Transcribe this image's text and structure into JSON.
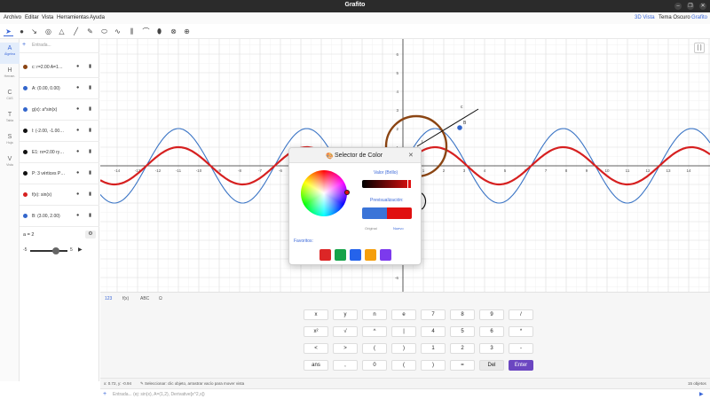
{
  "window": {
    "title": "Grafito",
    "controls": [
      "–",
      "❐",
      "✕"
    ]
  },
  "menu": {
    "items": [
      "Archivo",
      "Editar",
      "Vista",
      "Herramientas",
      "Ayuda"
    ],
    "right": [
      "3D Vista",
      "Tema Oscuro",
      "Grafito"
    ],
    "right_color": "#3a67d8"
  },
  "toolbar": {
    "tools": [
      "pointer",
      "point",
      "pen",
      "circle",
      "polygon",
      "line",
      "pencil",
      "ellipse",
      "wave",
      "ticks",
      "bend",
      "shape",
      "steering",
      "globe"
    ]
  },
  "rail": [
    {
      "letter": "A",
      "label": "Álgebra",
      "active": true
    },
    {
      "letter": "H",
      "label": "Herram.",
      "active": false
    },
    {
      "letter": "C",
      "label": "CAS",
      "active": false
    },
    {
      "letter": "T",
      "label": "Tabla",
      "active": false
    },
    {
      "letter": "S",
      "label": "Hoja",
      "active": false
    },
    {
      "letter": "V",
      "label": "Vista",
      "active": false
    }
  ],
  "algebra": {
    "input_placeholder": "Entrada...",
    "items": [
      {
        "label": "c: r=2.00  A=1…",
        "color": "#8b4513"
      },
      {
        "label": "A: (0.00, 0.00)",
        "color": "#3366cc"
      },
      {
        "label": "g(x): a*sin(x)",
        "color": "#3366cc"
      },
      {
        "label": "l: (-2.00, -1.00…",
        "color": "#111111"
      },
      {
        "label": "E1: rx=2.00 ry…",
        "color": "#111111"
      },
      {
        "label": "P: 3 vértices  P…",
        "color": "#111111"
      },
      {
        "label": "f(x): sin(x)",
        "color": "#d62020"
      },
      {
        "label": "B: (3.00, 2.00)",
        "color": "#3366cc"
      }
    ],
    "slider": {
      "name": "a = 2",
      "min": "-5",
      "max": "5",
      "value": 2,
      "range": [
        -5,
        5
      ]
    }
  },
  "graph": {
    "x_ticks": [
      "-14",
      "-13",
      "-12",
      "-11",
      "-10",
      "-9",
      "-8",
      "-7",
      "-6",
      "-5",
      "-4",
      "-3",
      "-2",
      "-1",
      "0",
      "1",
      "2",
      "3",
      "4",
      "5",
      "6",
      "7",
      "8",
      "9",
      "10",
      "11",
      "12",
      "13",
      "14"
    ],
    "y_ticks": [
      "6",
      "5",
      "4",
      "3",
      "2",
      "1",
      "-1",
      "-2",
      "-3",
      "-4",
      "-5",
      "-6"
    ],
    "labels": [
      "c",
      "B",
      "l"
    ],
    "colors": {
      "sin": "#d62020",
      "asin": "#3a74c5",
      "circle": "#8b4513",
      "segment": "#111111",
      "point": "#3366cc"
    }
  },
  "dialog": {
    "title": "Selector de Color",
    "value_label": "Valor (Brillo)",
    "preview_label": "Previsualización:",
    "original_label": "Original",
    "new_label": "Nuevo",
    "favorites_label": "Favoritos:",
    "favorites": [
      "#dc2626",
      "#16a34a",
      "#2563eb",
      "#f59e0b",
      "#7c3aed"
    ],
    "original_color": "#3a74d8",
    "new_color": "#e01010"
  },
  "keyboard": {
    "tabs": [
      "123",
      "f(x)",
      "ABC",
      "Ω"
    ],
    "rows": [
      [
        "x",
        "y",
        "n",
        "e",
        "7",
        "8",
        "9",
        "/"
      ],
      [
        "x²",
        "√",
        "^",
        "|",
        "4",
        "5",
        "6",
        "*"
      ],
      [
        "<",
        ">",
        "(",
        ")",
        "1",
        "2",
        "3",
        "-"
      ],
      [
        "ans",
        ",",
        "0",
        "(",
        ")",
        "=",
        "Del",
        "Enter"
      ]
    ]
  },
  "status": {
    "coords": "x: 0.72, y: -0.94",
    "hint": "✎ Seleccionar: clic objeto, arrastrar vacío para mover vista",
    "count": "15 objetos"
  },
  "inputbar": {
    "placeholder": "Entrada... (ej: sin(x), A=(1,2), Derivative[x^2,x])"
  }
}
